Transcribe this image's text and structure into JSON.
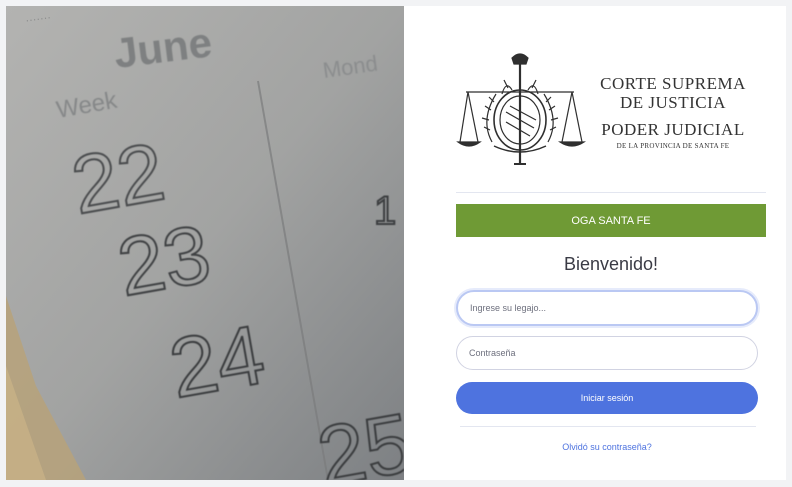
{
  "photo": {
    "month": "June",
    "column_left": "Week",
    "column_right": "Mond",
    "weeks": [
      "22",
      "23",
      "24",
      "25"
    ],
    "day_fragment": "1"
  },
  "logo": {
    "line1": "CORTE SUPREMA",
    "line2": "DE JUSTICIA",
    "line3": "PODER JUDICIAL",
    "line4": "DE LA PROVINCIA DE SANTA FE"
  },
  "banner": {
    "label": "OGA SANTA FE"
  },
  "welcome": "Bienvenido!",
  "form": {
    "legajo_placeholder": "Ingrese su legajo...",
    "password_placeholder": "Contraseña",
    "submit_label": "Iniciar sesión",
    "forgot_label": "Olvidó su contraseña?"
  },
  "colors": {
    "banner": "#6f9a35",
    "primary": "#4e73df"
  }
}
